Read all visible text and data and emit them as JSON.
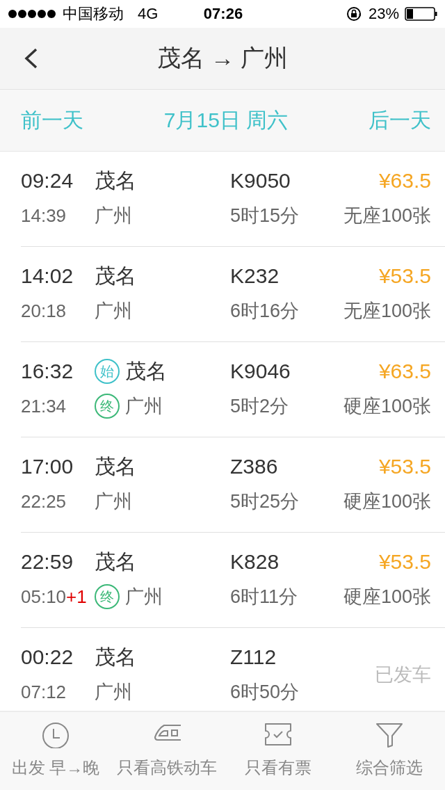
{
  "status_bar": {
    "carrier": "中国移动",
    "network": "4G",
    "time": "07:26",
    "battery": "23%"
  },
  "nav": {
    "title": "茂名 → 广州"
  },
  "date_bar": {
    "prev": "前一天",
    "date": "7月15日 周六",
    "next": "后一天"
  },
  "trains": [
    {
      "depart": "09:24",
      "arrive": "14:39",
      "from": "茂名",
      "to": "广州",
      "number": "K9050",
      "duration": "5时15分",
      "price": "¥63.5",
      "seats": "无座100张"
    },
    {
      "depart": "14:02",
      "arrive": "20:18",
      "from": "茂名",
      "to": "广州",
      "number": "K232",
      "duration": "6时16分",
      "price": "¥53.5",
      "seats": "无座100张"
    },
    {
      "depart": "16:32",
      "arrive": "21:34",
      "from": "茂名",
      "to": "广州",
      "from_badge": {
        "text": "始",
        "kind": "origin"
      },
      "to_badge": {
        "text": "终",
        "kind": "terminal"
      },
      "number": "K9046",
      "duration": "5时2分",
      "price": "¥63.5",
      "seats": "硬座100张"
    },
    {
      "depart": "17:00",
      "arrive": "22:25",
      "from": "茂名",
      "to": "广州",
      "number": "Z386",
      "duration": "5时25分",
      "price": "¥53.5",
      "seats": "硬座100张"
    },
    {
      "depart": "22:59",
      "arrive": "05:10",
      "day_offset": "+1",
      "from": "茂名",
      "to": "广州",
      "to_badge": {
        "text": "终",
        "kind": "terminal"
      },
      "number": "K828",
      "duration": "6时11分",
      "price": "¥53.5",
      "seats": "硬座100张"
    },
    {
      "depart": "00:22",
      "arrive": "07:12",
      "from": "茂名",
      "to": "广州",
      "number": "Z112",
      "duration": "6时50分",
      "status": "已发车"
    }
  ],
  "tab_bar": [
    {
      "kind": "clock",
      "label": "出发 早→晚"
    },
    {
      "kind": "train",
      "label": "只看高铁动车"
    },
    {
      "kind": "ticket",
      "label": "只看有票"
    },
    {
      "kind": "filter",
      "label": "综合筛选"
    }
  ]
}
